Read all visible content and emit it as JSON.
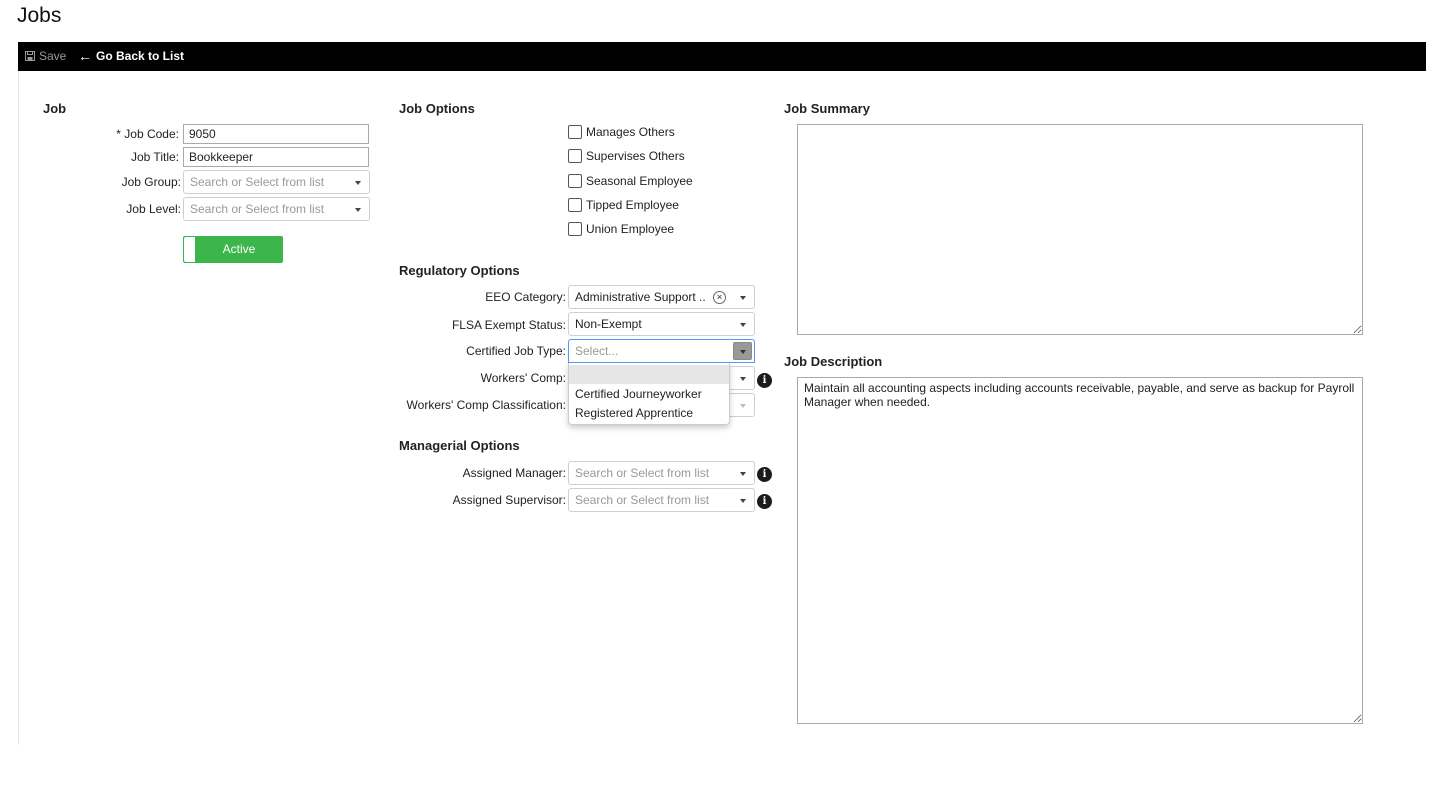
{
  "page": {
    "title": "Jobs"
  },
  "toolbar": {
    "save_label": "Save",
    "back_label": "Go Back to List",
    "back_arrow": "←"
  },
  "job": {
    "section_title": "Job",
    "code_label": "* Job Code:",
    "code_value": "9050",
    "title_label": "Job Title:",
    "title_value": "Bookkeeper",
    "group_label": "Job Group:",
    "group_placeholder": "Search or Select from list",
    "level_label": "Job Level:",
    "level_placeholder": "Search or Select from list",
    "status_label": "Active"
  },
  "job_options": {
    "section_title": "Job Options",
    "checkboxes": [
      {
        "label": "Manages Others",
        "checked": false
      },
      {
        "label": "Supervises Others",
        "checked": false
      },
      {
        "label": "Seasonal Employee",
        "checked": false
      },
      {
        "label": "Tipped Employee",
        "checked": false
      },
      {
        "label": "Union Employee",
        "checked": false
      }
    ]
  },
  "regulatory": {
    "section_title": "Regulatory Options",
    "eeo_label": "EEO Category:",
    "eeo_value": "Administrative Support ...",
    "flsa_label": "FLSA Exempt Status:",
    "flsa_value": "Non-Exempt",
    "certified_label": "Certified Job Type:",
    "certified_placeholder": "Select...",
    "certified_options": [
      "",
      "Certified Journeyworker",
      "Registered Apprentice"
    ],
    "workers_comp_label": "Workers' Comp:",
    "workers_comp_class_label": "Workers' Comp Classification:"
  },
  "managerial": {
    "section_title": "Managerial Options",
    "manager_label": "Assigned Manager:",
    "manager_placeholder": "Search or Select from list",
    "supervisor_label": "Assigned Supervisor:",
    "supervisor_placeholder": "Search or Select from list"
  },
  "summary": {
    "section_title": "Job Summary",
    "value": ""
  },
  "description": {
    "section_title": "Job Description",
    "value": "Maintain all accounting aspects including accounts receivable, payable, and serve as backup for Payroll Manager when needed."
  },
  "colors": {
    "toolbar_bg": "#000000",
    "active_green": "#3cb54a",
    "focus_blue": "#5897fb"
  },
  "icons": {
    "save": "save-icon",
    "back": "arrow-left-icon",
    "info": "info-icon",
    "clear": "clear-circle-icon"
  }
}
